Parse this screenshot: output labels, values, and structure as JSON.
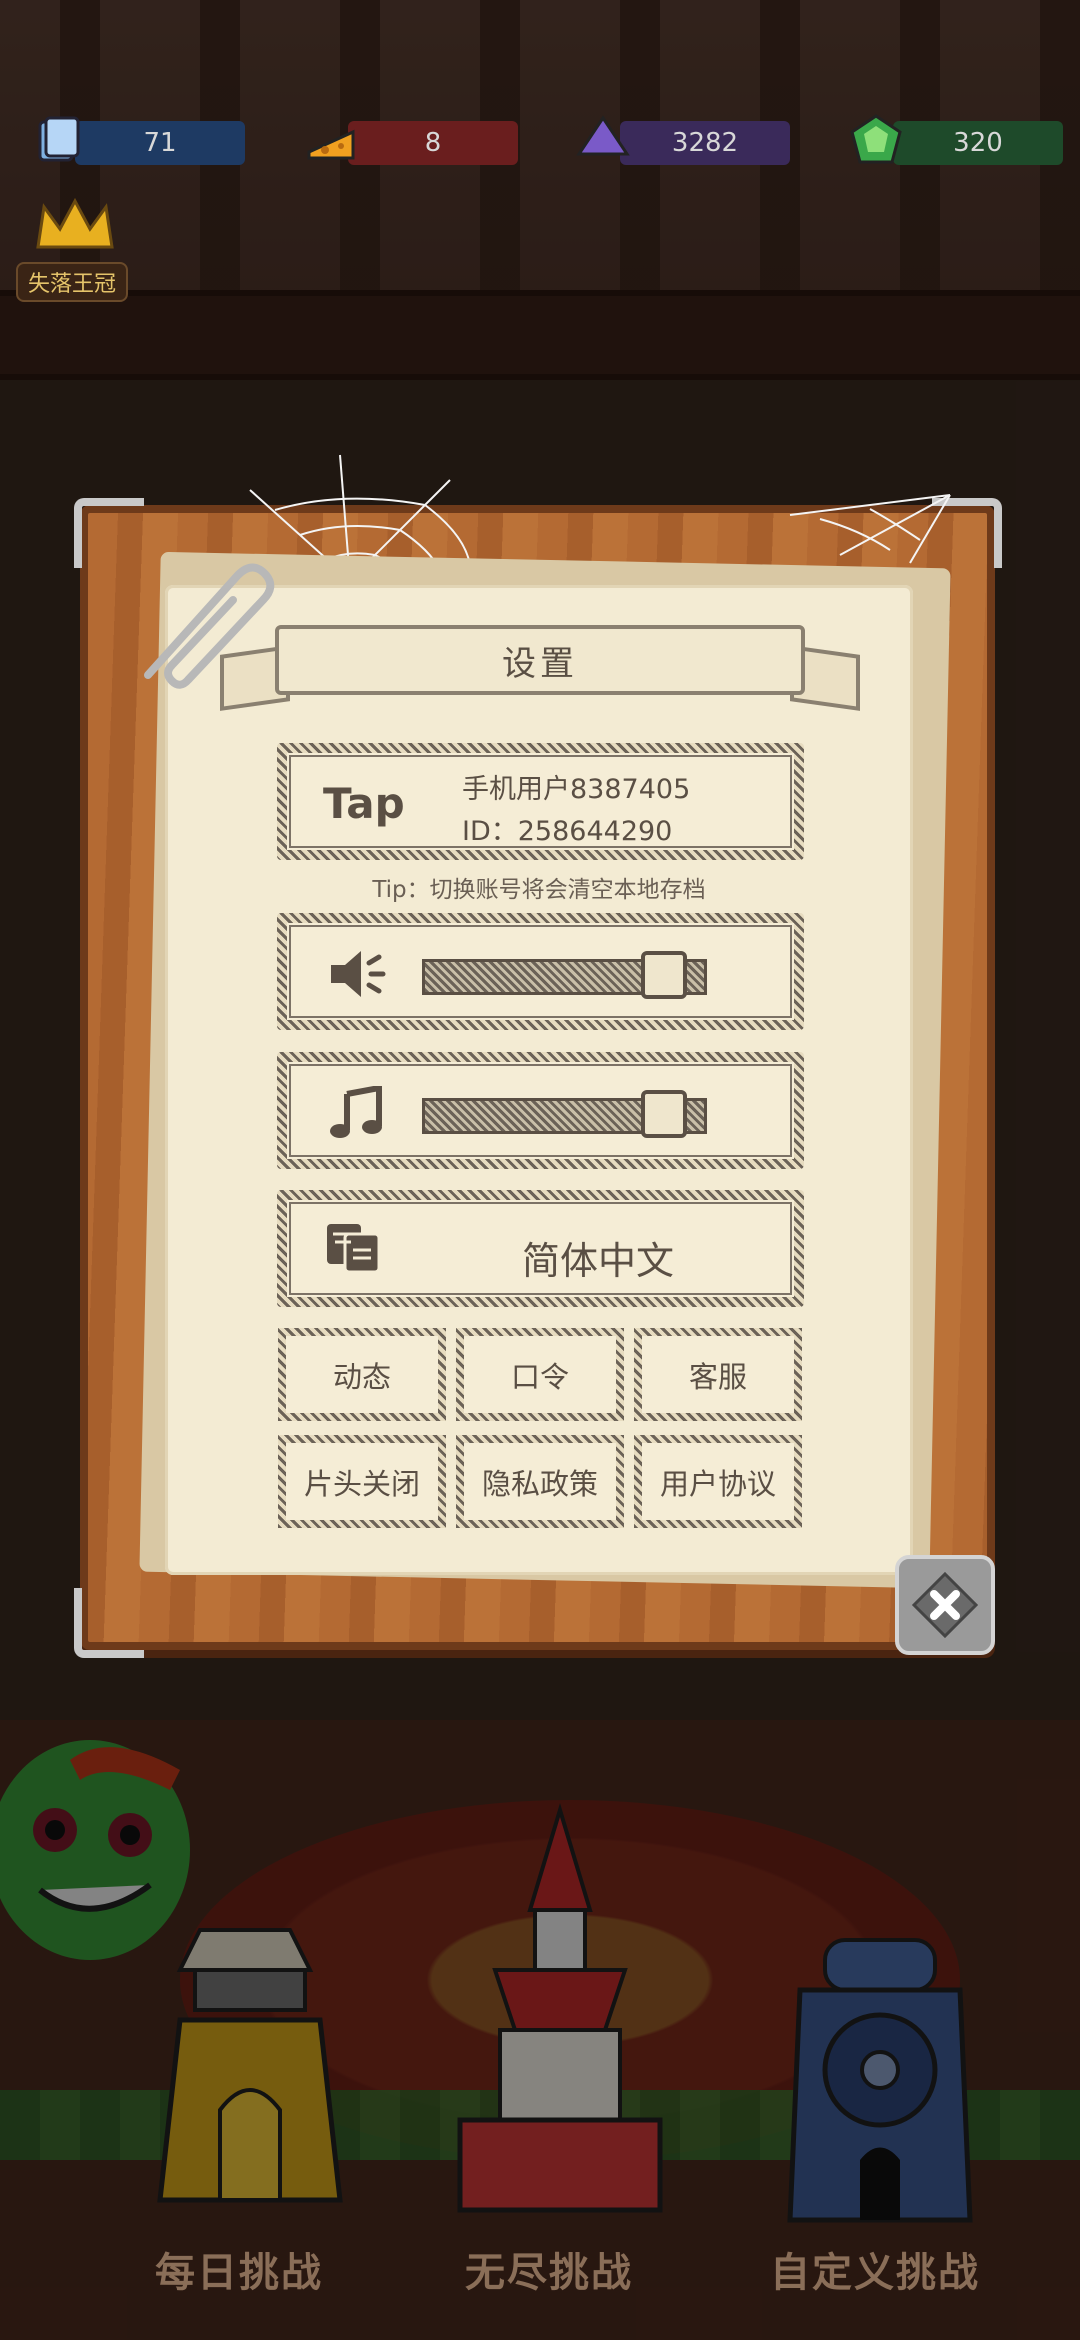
{
  "resources": [
    {
      "icon": "card-icon",
      "value": "71",
      "color": "#1e3a63"
    },
    {
      "icon": "cheese-icon",
      "value": "8",
      "color": "#6a1e1e"
    },
    {
      "icon": "crystal-icon",
      "value": "3282",
      "color": "#3a2a5a"
    },
    {
      "icon": "gem-icon",
      "value": "320",
      "color": "#1e4a2a"
    }
  ],
  "crown": {
    "label": "失落王冠"
  },
  "settings": {
    "title": "设置",
    "account": {
      "logo": "Tap",
      "name": "手机用户8387405",
      "id": "ID：258644290"
    },
    "tip": "Tip：切换账号将会清空本地存档",
    "sound_volume": 0.85,
    "music_volume": 0.85,
    "language": "简体中文",
    "buttons_row1": [
      "动态",
      "口令",
      "客服"
    ],
    "buttons_row2": [
      "片头关闭",
      "隐私政策",
      "用户协议"
    ]
  },
  "bottom_nav": [
    "每日挑战",
    "无尽挑战",
    "自定义挑战"
  ]
}
